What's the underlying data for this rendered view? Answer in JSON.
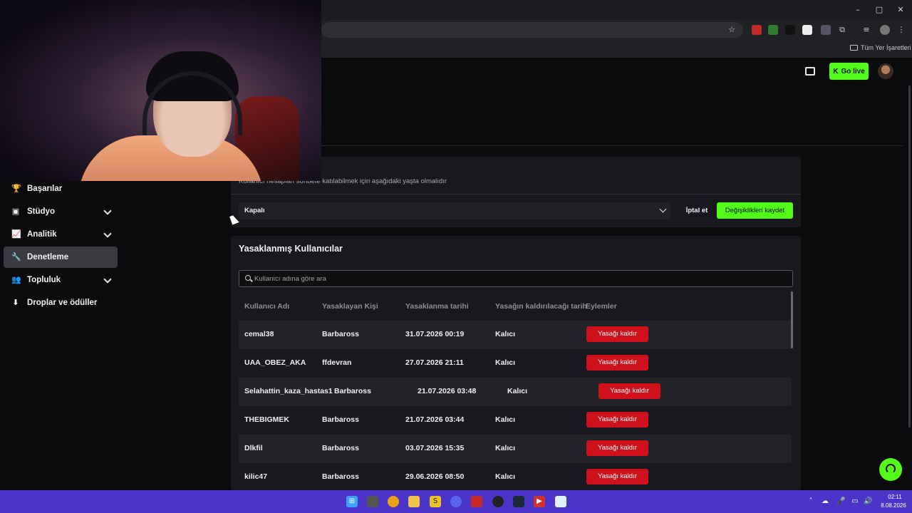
{
  "browser": {
    "bookmarks_all": "Tüm Yer İşaretleri",
    "window_controls": {
      "minimize": "–",
      "maximize": "□",
      "close": "✕"
    }
  },
  "header": {
    "go_live_label": "Go live",
    "go_live_icon": "K"
  },
  "sidebar": {
    "items": [
      {
        "label": "Başarılar",
        "icon": "trophy-icon",
        "glyph": "🏆",
        "expandable": false,
        "active": false
      },
      {
        "label": "Stüdyo",
        "icon": "studio-icon",
        "glyph": "▣",
        "expandable": true,
        "active": false
      },
      {
        "label": "Analitik",
        "icon": "chart-icon",
        "glyph": "📈",
        "expandable": true,
        "active": false
      },
      {
        "label": "Denetleme",
        "icon": "wrench-icon",
        "glyph": "🔧",
        "expandable": false,
        "active": true
      },
      {
        "label": "Topluluk",
        "icon": "community-icon",
        "glyph": "👥",
        "expandable": true,
        "active": false
      },
      {
        "label": "Droplar ve ödüller",
        "icon": "drops-icon",
        "glyph": "⬇",
        "expandable": false,
        "active": false
      }
    ]
  },
  "age_settings": {
    "description": "Kullanıcı hesapları sohbete katılabilmek için aşağıdaki yaşta olmalıdır",
    "selected_value": "Kapalı",
    "cancel_label": "İptal et",
    "save_label": "Değişiklikleri kaydet"
  },
  "bans": {
    "title": "Yasaklanmış Kullanıcılar",
    "search_placeholder": "Kullanıcı adına göre ara",
    "columns": [
      "Kullanıcı Adı",
      "Yasaklayan Kişi",
      "Yasaklanma tarihi",
      "Yasağın kaldırılacağı tarih",
      "Eylemler"
    ],
    "unban_label": "Yasağı kaldır",
    "rows": [
      {
        "username": "cemal38",
        "banned_by": "Barbaross",
        "ban_date": "31.07.2026 00:19",
        "unban_date": "Kalıcı"
      },
      {
        "username": "UAA_OBEZ_AKA",
        "banned_by": "ffdevran",
        "ban_date": "27.07.2026 21:11",
        "unban_date": "Kalıcı"
      },
      {
        "username": "Selahattin_kaza_hastas1",
        "banned_by": "Barbaross",
        "ban_date": "21.07.2026 03:48",
        "unban_date": "Kalıcı"
      },
      {
        "username": "THEBIGMEK",
        "banned_by": "Barbaross",
        "ban_date": "21.07.2026 03:44",
        "unban_date": "Kalıcı"
      },
      {
        "username": "Dlkfil",
        "banned_by": "Barbaross",
        "ban_date": "03.07.2026 15:35",
        "unban_date": "Kalıcı"
      },
      {
        "username": "kilic47",
        "banned_by": "Barbaross",
        "ban_date": "29.06.2026 08:50",
        "unban_date": "Kalıcı"
      }
    ]
  },
  "taskbar": {
    "time": "02:11",
    "date": "8.08.2026"
  },
  "colors": {
    "accent_green": "#53fc18",
    "danger_red": "#d0101b",
    "taskbar_purple": "#4b35c9"
  }
}
